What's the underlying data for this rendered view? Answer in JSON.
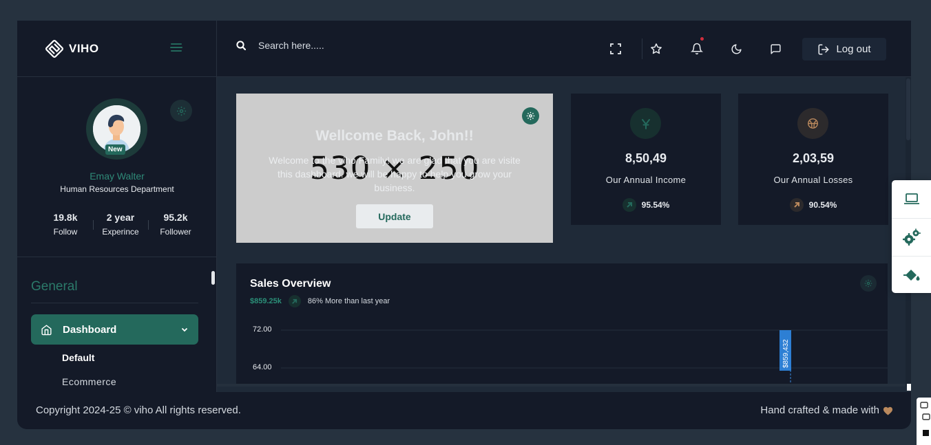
{
  "brand": {
    "name": "VIHO"
  },
  "search": {
    "placeholder": "Search here....."
  },
  "header": {
    "logout_label": "Log out"
  },
  "profile": {
    "name": "Emay Walter",
    "department": "Human Resources Department",
    "badge": "New",
    "stats": [
      {
        "value": "19.8k",
        "label": "Follow"
      },
      {
        "value": "2 year",
        "label": "Experince"
      },
      {
        "value": "95.2k",
        "label": "Follower"
      }
    ]
  },
  "sidebar": {
    "section_title": "General",
    "active_item": "Dashboard",
    "sub_items": [
      "Default",
      "Ecommerce"
    ]
  },
  "welcome": {
    "title": "Wellcome Back, John!!",
    "text": "Welcome to the viho Family! we are glad that you are visite this dashboard. we will be happy to help you grow your business.",
    "placeholder": "530 × 250",
    "button": "Update"
  },
  "cards": [
    {
      "value": "8,50,49",
      "label": "Our Annual Income",
      "pct": "95.54%",
      "icon": "yen-icon",
      "color": "#24695c"
    },
    {
      "value": "2,03,59",
      "label": "Our Annual Losses",
      "pct": "90.54%",
      "icon": "basketball-icon",
      "color": "#ba895d"
    }
  ],
  "sales": {
    "title": "Sales Overview",
    "amount": "$859.25k",
    "note": "86% More than last year",
    "y_ticks": [
      "72.00",
      "64.00"
    ],
    "marker_label": "$859,432"
  },
  "footer": {
    "copyright": "Copyright 2024-25 © viho All rights reserved.",
    "crafted": "Hand crafted & made with"
  },
  "colors": {
    "primary": "#24695c",
    "secondary": "#ba895d",
    "dark": "#141a28"
  }
}
